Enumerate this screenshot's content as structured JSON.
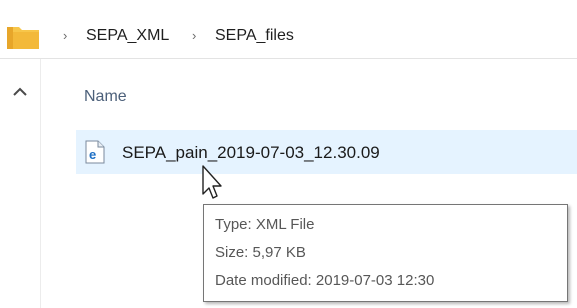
{
  "breadcrumb": {
    "separator": "›",
    "items": [
      {
        "label": "SEPA_XML"
      },
      {
        "label": "SEPA_files"
      }
    ]
  },
  "columns": {
    "name_header": "Name"
  },
  "files": [
    {
      "name": "SEPA_pain_2019-07-03_12.30.09",
      "icon": "ie-xml-document-icon"
    }
  ],
  "tooltip": {
    "type_line": "Type: XML File",
    "size_line": "Size: 5,97 KB",
    "date_line": "Date modified: 2019-07-03 12:30"
  },
  "colors": {
    "selection": "#e5f3ff",
    "folder": "#f7c64a",
    "ie_blue": "#1e6fc5",
    "header_text": "#4c607a"
  }
}
